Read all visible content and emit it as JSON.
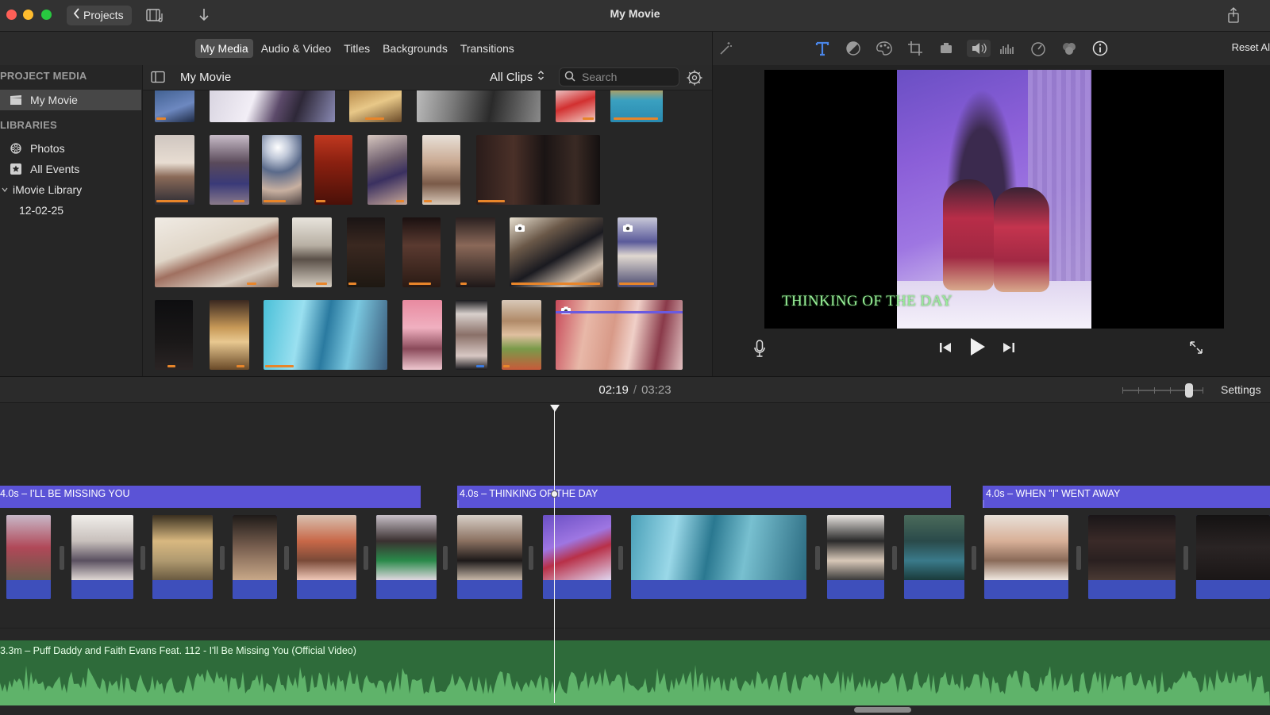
{
  "titlebar": {
    "back_label": "Projects",
    "window_title": "My Movie"
  },
  "browser_tabs": [
    "My Media",
    "Audio & Video",
    "Titles",
    "Backgrounds",
    "Transitions"
  ],
  "viewer_toolbar": {
    "reset_label": "Reset Al"
  },
  "sidebar": {
    "project_media_header": "PROJECT MEDIA",
    "project_item": "My Movie",
    "libraries_header": "LIBRARIES",
    "items": [
      {
        "label": "Photos",
        "icon": "photos-icon"
      },
      {
        "label": "All Events",
        "icon": "star-icon"
      },
      {
        "label": "iMovie Library",
        "icon": "disclosure-icon"
      },
      {
        "label": "12-02-25",
        "icon": ""
      }
    ]
  },
  "media_header": {
    "title": "My Movie",
    "clips_filter": "All Clips",
    "search_placeholder": "Search"
  },
  "viewer": {
    "overlay_title": "THINKING OF THE DAY"
  },
  "timeline": {
    "current_time": "02:19",
    "separator": "/",
    "total_time": "03:23",
    "settings_label": "Settings",
    "title_clips": [
      {
        "label": "4.0s – I'LL BE MISSING YOU"
      },
      {
        "label": "4.0s – THINKING OF THE DAY"
      },
      {
        "label": "4.0s – WHEN  \"I\" WENT AWAY"
      }
    ],
    "audio_label": "3.3m – Puff Daddy and Faith Evans Feat. 112 - I'll Be Missing You (Official Video)"
  },
  "colors": {
    "title_clip": "#5b53d6",
    "video_band": "#3e4fbb",
    "audio_track": "#2e6b3a",
    "accent_orange": "#e8852a"
  }
}
